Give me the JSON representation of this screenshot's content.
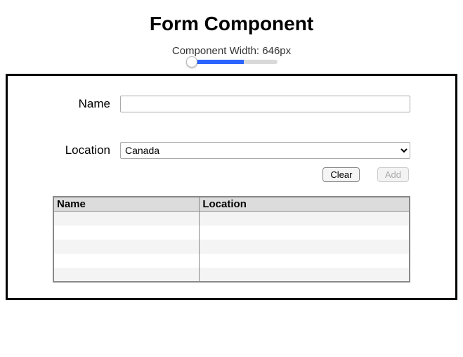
{
  "title": "Form Component",
  "widthControl": {
    "labelPrefix": "Component Width: ",
    "value": 646,
    "unit": "px",
    "min": 400,
    "max": 800
  },
  "form": {
    "name": {
      "label": "Name",
      "value": ""
    },
    "location": {
      "label": "Location",
      "value": "Canada",
      "options": [
        "Canada"
      ]
    }
  },
  "buttons": {
    "clear": "Clear",
    "add": "Add",
    "addDisabled": true
  },
  "table": {
    "headers": {
      "name": "Name",
      "location": "Location"
    },
    "rows": [
      {
        "name": "",
        "location": ""
      },
      {
        "name": "",
        "location": ""
      },
      {
        "name": "",
        "location": ""
      },
      {
        "name": "",
        "location": ""
      },
      {
        "name": "",
        "location": ""
      }
    ]
  }
}
